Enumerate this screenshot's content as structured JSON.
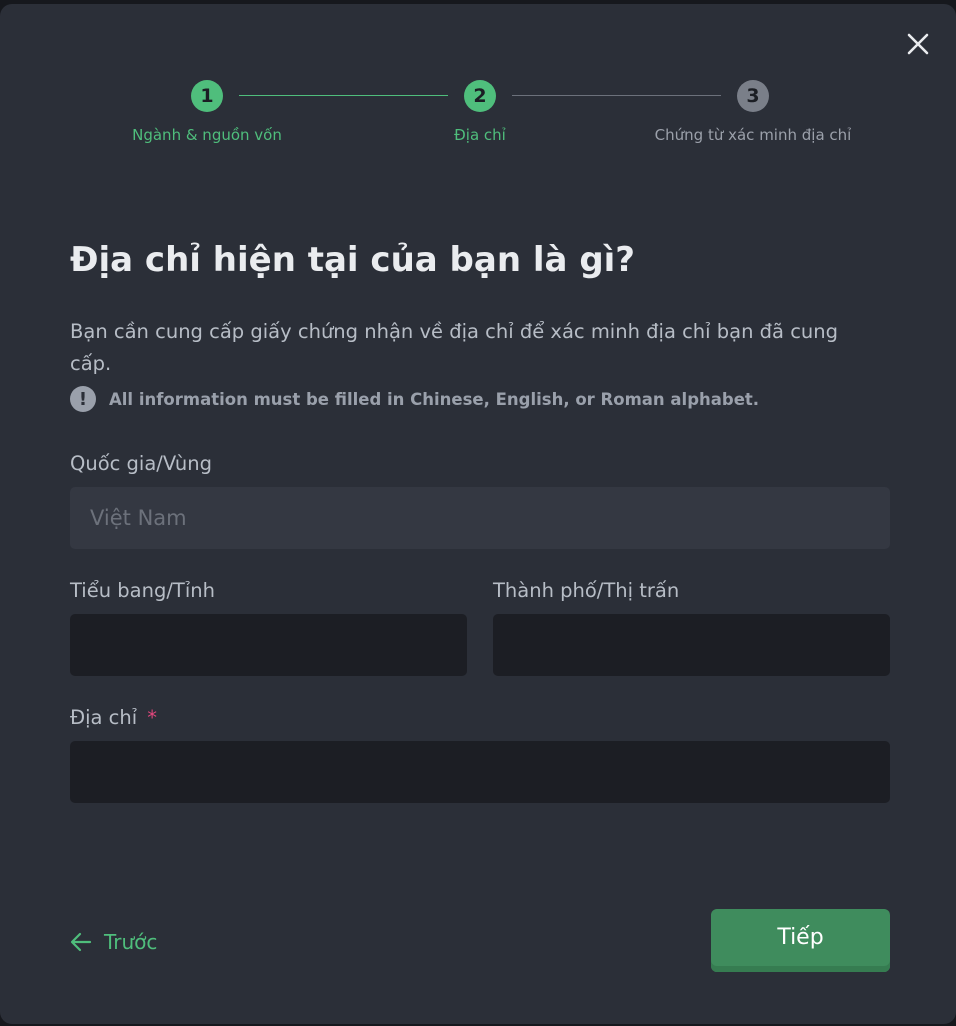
{
  "colors": {
    "accent": "#4fbe7c",
    "pending": "#7a7f89",
    "required": "#e0467c",
    "button": "#3f8c5d"
  },
  "stepper": {
    "steps": [
      {
        "number": "1",
        "label": "Ngành & nguồn vốn",
        "state": "done"
      },
      {
        "number": "2",
        "label": "Địa chỉ",
        "state": "active"
      },
      {
        "number": "3",
        "label": "Chứng từ xác minh địa chỉ",
        "state": "pending"
      }
    ]
  },
  "form": {
    "title": "Địa chỉ hiện tại của bạn là gì?",
    "description": "Bạn cần cung cấp giấy chứng nhận về địa chỉ để xác minh địa chỉ bạn đã cung cấp.",
    "notice": "All information must be filled in Chinese, English, or Roman alphabet.",
    "notice_icon": "exclamation-icon",
    "country": {
      "label": "Quốc gia/Vùng",
      "value": "Việt Nam"
    },
    "state": {
      "label": "Tiểu bang/Tỉnh",
      "value": ""
    },
    "city": {
      "label": "Thành phố/Thị trấn",
      "value": ""
    },
    "address": {
      "label": "Địa chỉ",
      "required_mark": "*",
      "value": ""
    }
  },
  "footer": {
    "back_label": "Trước",
    "back_icon": "arrow-left-icon",
    "next_label": "Tiếp"
  },
  "close_icon": "close-icon"
}
